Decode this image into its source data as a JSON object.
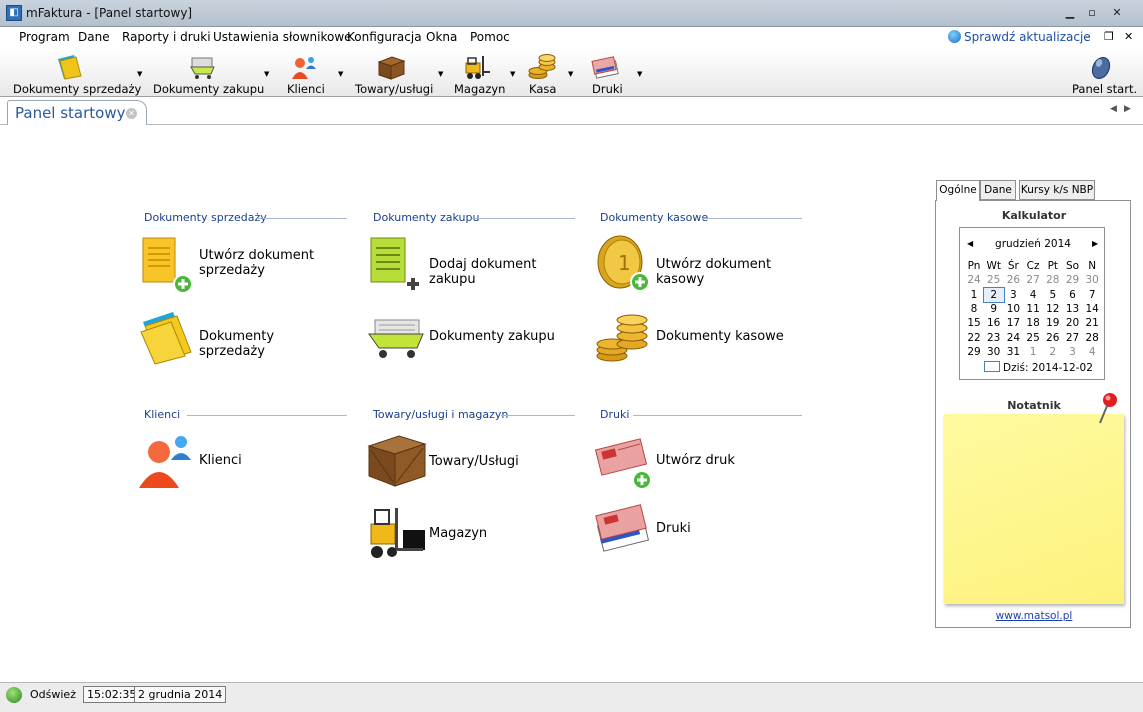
{
  "window": {
    "title": "mFaktura - [Panel startowy]",
    "icon_name": "app-icon"
  },
  "menu": {
    "items": [
      "Program",
      "Dane",
      "Raporty i druki",
      "Ustawienia słownikowe",
      "Konfiguracja",
      "Okna",
      "Pomoc"
    ],
    "update_label": "Sprawdź aktualizacje"
  },
  "toolbar": {
    "buttons": [
      {
        "label": "Dokumenty sprzedaży",
        "icon": "folder-icon"
      },
      {
        "label": "Dokumenty zakupu",
        "icon": "shopping-cart-icon"
      },
      {
        "label": "Klienci",
        "icon": "clients-icon"
      },
      {
        "label": "Towary/usługi",
        "icon": "crate-icon"
      },
      {
        "label": "Magazyn",
        "icon": "forklift-icon"
      },
      {
        "label": "Kasa",
        "icon": "coins-icon"
      },
      {
        "label": "Druki",
        "icon": "forms-icon"
      }
    ],
    "start_panel_label": "Panel start."
  },
  "tabs": {
    "active_label": "Panel startowy"
  },
  "sections": {
    "sales": {
      "title": "Dokumenty sprzedaży",
      "create_label_line1": "Utwórz dokument",
      "create_label_line2": "sprzedaży",
      "list_label": "Dokumenty sprzedaży"
    },
    "purchase": {
      "title": "Dokumenty zakupu",
      "create_label": "Dodaj dokument zakupu",
      "list_label": "Dokumenty zakupu"
    },
    "cash": {
      "title": "Dokumenty kasowe",
      "create_label": "Utwórz dokument kasowy",
      "list_label": "Dokumenty kasowe"
    },
    "clients": {
      "title": "Klienci",
      "list_label": "Klienci"
    },
    "goods": {
      "title": "Towary/usługi i magazyn",
      "goods_label": "Towary/Usługi",
      "warehouse_label": "Magazyn"
    },
    "prints": {
      "title": "Druki",
      "create_label": "Utwórz druk",
      "list_label": "Druki"
    }
  },
  "side_panel": {
    "tabs": [
      "Ogólne",
      "Dane",
      "Kursy k/s NBP"
    ],
    "calculator_title": "Kalkulator",
    "calendar": {
      "month_label": "grudzień 2014",
      "day_names": [
        "Pn",
        "Wt",
        "Śr",
        "Cz",
        "Pt",
        "So",
        "N"
      ],
      "weeks": [
        [
          "24",
          "25",
          "26",
          "27",
          "28",
          "29",
          "30"
        ],
        [
          "1",
          "2",
          "3",
          "4",
          "5",
          "6",
          "7"
        ],
        [
          "8",
          "9",
          "10",
          "11",
          "12",
          "13",
          "14"
        ],
        [
          "15",
          "16",
          "17",
          "18",
          "19",
          "20",
          "21"
        ],
        [
          "22",
          "23",
          "24",
          "25",
          "26",
          "27",
          "28"
        ],
        [
          "29",
          "30",
          "31",
          "1",
          "2",
          "3",
          "4"
        ]
      ],
      "today_label": "Dziś: 2014-12-02"
    },
    "notes_title": "Notatnik",
    "site_link": "www.matsol.pl"
  },
  "status": {
    "refresh_label": "Odśwież",
    "time": "15:02:35",
    "date": "2 grudnia 2014"
  }
}
